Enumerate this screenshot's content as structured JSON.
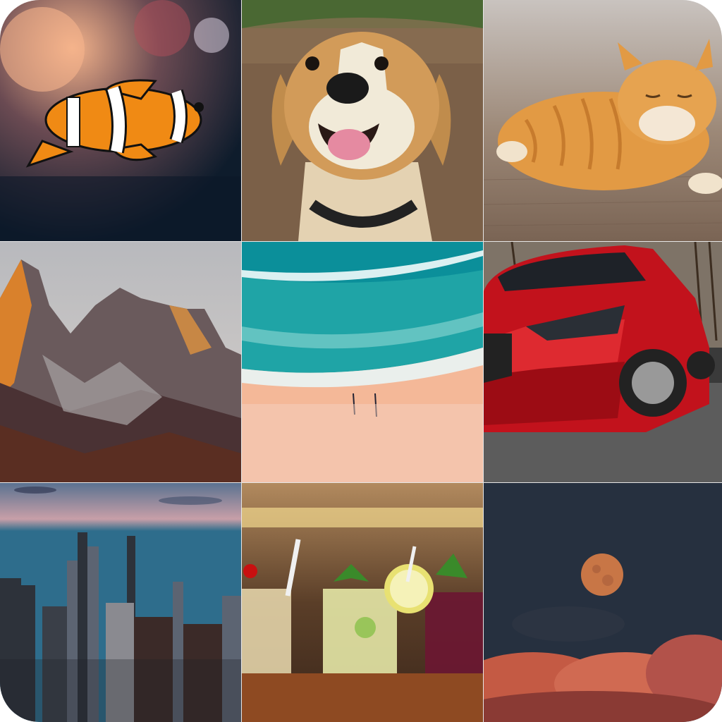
{
  "grid": {
    "tiles": [
      {
        "icon": "clownfish-icon"
      },
      {
        "icon": "dog-icon"
      },
      {
        "icon": "cat-icon"
      },
      {
        "icon": "mountains-icon"
      },
      {
        "icon": "beach-icon"
      },
      {
        "icon": "car-icon"
      },
      {
        "icon": "city-icon"
      },
      {
        "icon": "cocktails-icon"
      },
      {
        "icon": "moon-icon"
      }
    ]
  },
  "colors": {
    "grid_gap": "#e6e6e6",
    "background": "#ffffff"
  }
}
